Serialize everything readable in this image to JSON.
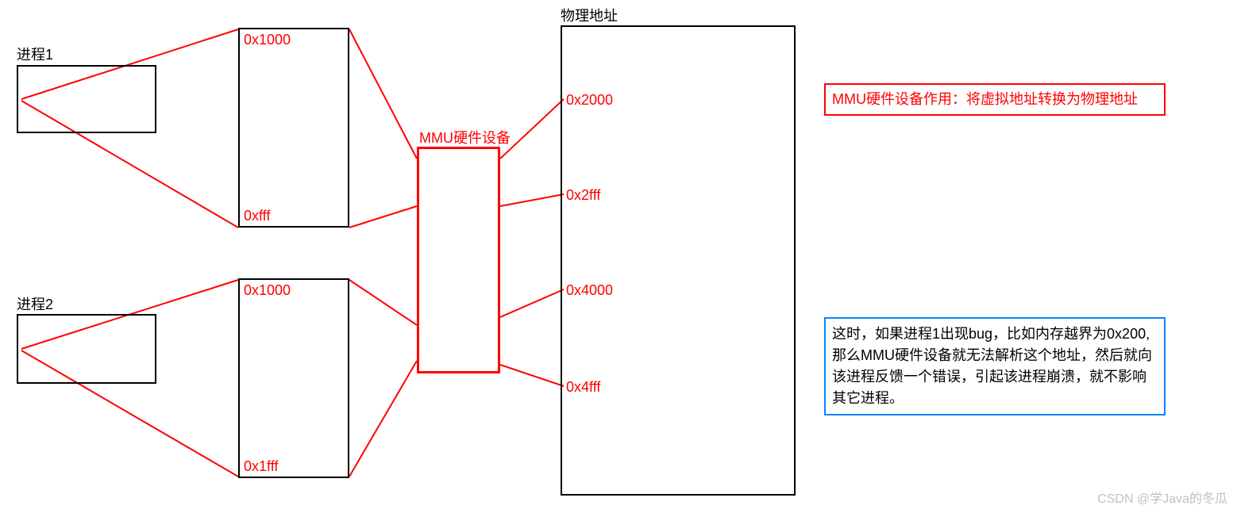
{
  "process1": {
    "title": "进程1"
  },
  "process2": {
    "title": "进程2"
  },
  "virt1": {
    "start": "0x1000",
    "end": "0xfff"
  },
  "virt2": {
    "start": "0x1000",
    "end": "0x1fff"
  },
  "mmu": {
    "label": "MMU硬件设备"
  },
  "phys": {
    "title": "物理地址",
    "a": "0x2000",
    "b": "0x2fff",
    "c": "0x4000",
    "d": "0x4fff"
  },
  "note_red": "MMU硬件设备作用：将虚拟地址转换为物理地址",
  "note_blue": "这时，如果进程1出现bug，比如内存越界为0x200,那么MMU硬件设备就无法解析这个地址，然后就向该进程反馈一个错误，引起该进程崩溃，就不影响其它进程。",
  "watermark": "CSDN @学Java的冬瓜"
}
